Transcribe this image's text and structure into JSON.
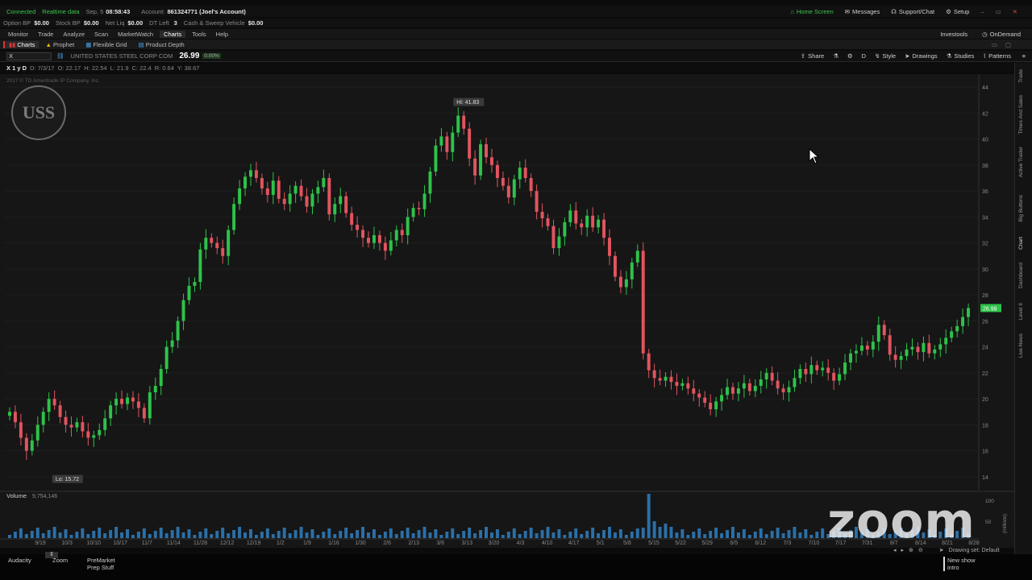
{
  "topbar": {
    "status": "Connected",
    "realtime": "Realtime data",
    "date": "Sep, 5",
    "time": "08:58:43",
    "account_label": "Account:",
    "account": "861324771 (Joel's Account)",
    "home": "Home Screen",
    "messages": "Messages",
    "support": "Support/Chat",
    "setup": "Setup"
  },
  "acctbar": {
    "items": [
      {
        "label": "Option BP",
        "value": "$0.00"
      },
      {
        "label": "Stock BP",
        "value": "$0.00"
      },
      {
        "label": "Net Liq",
        "value": "$0.00"
      },
      {
        "label": "DT Left",
        "value": "3"
      },
      {
        "label": "Cash & Sweep Vehicle",
        "value": "$0.00"
      }
    ]
  },
  "menu": {
    "items": [
      "Monitor",
      "Trade",
      "Analyze",
      "Scan",
      "MarketWatch",
      "Charts",
      "Tools",
      "Help"
    ],
    "investools": "Investools",
    "ondemand": "OnDemand"
  },
  "subtabs": {
    "items": [
      "Charts",
      "Prophet",
      "Flexible Grid",
      "Product Depth"
    ]
  },
  "symbar": {
    "symbol": "X",
    "company": "UNITED STATES STEEL CORP COM",
    "price": "26.99",
    "change": "0.00%",
    "tools": [
      "Share",
      "D",
      "Style",
      "Drawings",
      "Studies",
      "Patterns"
    ]
  },
  "infobar": {
    "symbol": "X 1 y D",
    "date": "D: 7/3/17",
    "open": "O: 22.17",
    "high": "H: 22.54",
    "low": "L: 21.9",
    "close": "C: 22.4",
    "range": "R: 0.64",
    "y": "Y: 38.67"
  },
  "chart_data": {
    "type": "candlestick",
    "copyright": "2017 © TD Ameritrade IP Company, Inc.",
    "hi_label": "Hi: 41.83",
    "lo_label": "Lo: 15.72",
    "last_label": "26.99",
    "volume_label": "Volume",
    "volume_value": "9,754,146",
    "ylim": [
      13,
      45
    ],
    "y_ticks": [
      14,
      16,
      18,
      20,
      22,
      24,
      26,
      28,
      30,
      32,
      34,
      36,
      38,
      40,
      42,
      44
    ],
    "x_ticks": [
      "9/19",
      "10/3",
      "10/10",
      "10/17",
      "11/7",
      "11/14",
      "11/28",
      "12/12",
      "12/19",
      "1/2",
      "1/9",
      "1/16",
      "1/30",
      "2/6",
      "2/13",
      "3/6",
      "3/13",
      "3/20",
      "4/3",
      "4/10",
      "4/17",
      "5/1",
      "5/8",
      "5/15",
      "5/22",
      "5/29",
      "6/5",
      "6/12",
      "7/3",
      "7/10",
      "7/17",
      "7/31",
      "8/7",
      "8/14",
      "8/21",
      "8/28"
    ],
    "volume_ticks": [
      "100",
      "50"
    ],
    "volume_unit": "(millions)",
    "closes": [
      19,
      18.2,
      17,
      16,
      16.8,
      18,
      19,
      20,
      19.5,
      18.6,
      18,
      17.8,
      18.2,
      17.5,
      17,
      17.2,
      17.6,
      18.5,
      19.5,
      20,
      19.6,
      20.1,
      19.8,
      19.3,
      18.5,
      20.5,
      21,
      22.3,
      24,
      24.5,
      26,
      27.6,
      28.7,
      29,
      31.5,
      32.4,
      32,
      31.6,
      31,
      33,
      35,
      36.2,
      37.1,
      37.6,
      37,
      36.2,
      35.7,
      36.8,
      35.4,
      35,
      35.8,
      36.4,
      35.6,
      34.8,
      35.8,
      36.3,
      37,
      34.2,
      35,
      35.6,
      34.3,
      33.4,
      33,
      32.4,
      32,
      32.6,
      32,
      31.4,
      32.2,
      33,
      32.6,
      34,
      34.7,
      34.6,
      35.8,
      37.5,
      39.5,
      40.2,
      39,
      40.5,
      41.8,
      40.8,
      38.5,
      37.2,
      39.6,
      38.6,
      38,
      37,
      36.4,
      35.5,
      36.9,
      37.8,
      37,
      36,
      34.4,
      33.9,
      33.3,
      31.6,
      32.5,
      33.6,
      34.5,
      33.5,
      33.2,
      34.1,
      33.2,
      33.8,
      32.4,
      31,
      29.4,
      28.6,
      29.2,
      30.5,
      31.4,
      23.5,
      22.2,
      21.6,
      21.4,
      21.7,
      21.3,
      21,
      21.2,
      20.8,
      20.4,
      20.1,
      19.7,
      19.2,
      19.8,
      20.3,
      20.9,
      20.4,
      20.8,
      21.2,
      20.6,
      21,
      21.5,
      22,
      21.4,
      20.8,
      20.5,
      20.9,
      21.6,
      22.3,
      21.9,
      22.6,
      22.2,
      22.4,
      22,
      21.4,
      21.9,
      22.8,
      23.5,
      23.7,
      24.1,
      23.8,
      24.4,
      25.7,
      24.9,
      23.4,
      23,
      23.3,
      23.8,
      24,
      23.6,
      24.3,
      23.5,
      23.8,
      24.2,
      24.7,
      25.2,
      25.6,
      26.3,
      26.99
    ]
  },
  "sidebar": {
    "tabs": [
      "Trade",
      "Times And Sales",
      "Active Trader",
      "Big Buttons",
      "Chart",
      "Dashboard",
      "Level II",
      "Live News"
    ]
  },
  "status": {
    "drawing_set": "Drawing set: Default"
  },
  "taskbar": {
    "items": [
      "Audacity",
      "Zoom",
      "PreMarket Prep Stuff",
      "New show intro"
    ]
  },
  "watermark": "zoom"
}
